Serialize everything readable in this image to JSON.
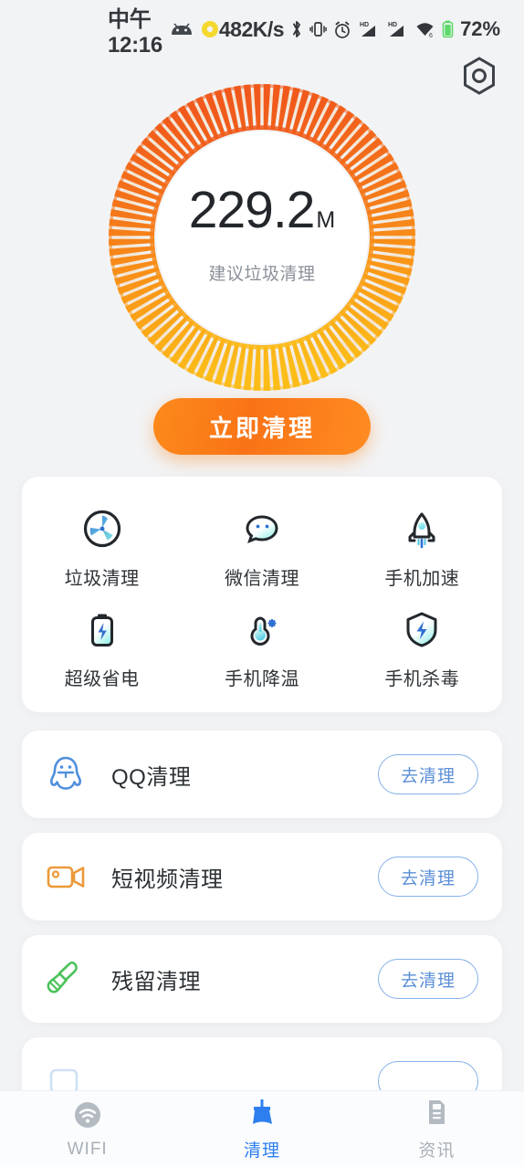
{
  "statusbar": {
    "time": "中午12:16",
    "android_icon": "android-robot-icon",
    "sun_icon": "brightness-dot-icon",
    "network_speed": "482K/s",
    "bluetooth_icon": "bluetooth-icon",
    "vibrate_icon": "vibrate-icon",
    "alarm_icon": "alarm-clock-icon",
    "signal1_icon": "hd-signal-icon",
    "signal2_icon": "hd-signal-icon",
    "wifi_icon": "wifi-icon",
    "battery_icon": "battery-icon",
    "battery_percent": "72%"
  },
  "header": {
    "settings_icon": "hex-settings-icon"
  },
  "gauge": {
    "value": "229.2",
    "unit": "M",
    "subtitle": "建议垃圾清理",
    "ring_color_start": "#f2641e",
    "ring_color_end": "#fcb216",
    "progress_percent": 100
  },
  "clean_button": {
    "label": "立即清理",
    "color": "#f97316"
  },
  "tools": {
    "items": [
      {
        "label": "垃圾清理",
        "icon": "fan-circle-icon"
      },
      {
        "label": "微信清理",
        "icon": "wechat-bubble-icon"
      },
      {
        "label": "手机加速",
        "icon": "rocket-icon"
      },
      {
        "label": "超级省电",
        "icon": "battery-bolt-icon"
      },
      {
        "label": "手机降温",
        "icon": "thermometer-snow-icon"
      },
      {
        "label": "手机杀毒",
        "icon": "shield-bolt-icon"
      }
    ]
  },
  "list": {
    "items": [
      {
        "label": "QQ清理",
        "icon": "qq-penguin-icon",
        "action": "去清理",
        "color": "#5b95e0"
      },
      {
        "label": "短视频清理",
        "icon": "video-camera-icon",
        "action": "去清理",
        "color": "#eb9a3a"
      },
      {
        "label": "残留清理",
        "icon": "broom-icon",
        "action": "去清理",
        "color": "#4cc25a"
      },
      {
        "label": "",
        "icon": "",
        "action": "",
        "color": "#5b95e0"
      }
    ]
  },
  "bottom_nav": {
    "items": [
      {
        "label": "WIFI",
        "icon": "wifi-nav-icon",
        "active": false
      },
      {
        "label": "清理",
        "icon": "broom-nav-icon",
        "active": true
      },
      {
        "label": "资讯",
        "icon": "news-doc-icon",
        "active": false
      }
    ],
    "active_color": "#2d7ff0",
    "inactive_color": "#a9b0b8"
  }
}
